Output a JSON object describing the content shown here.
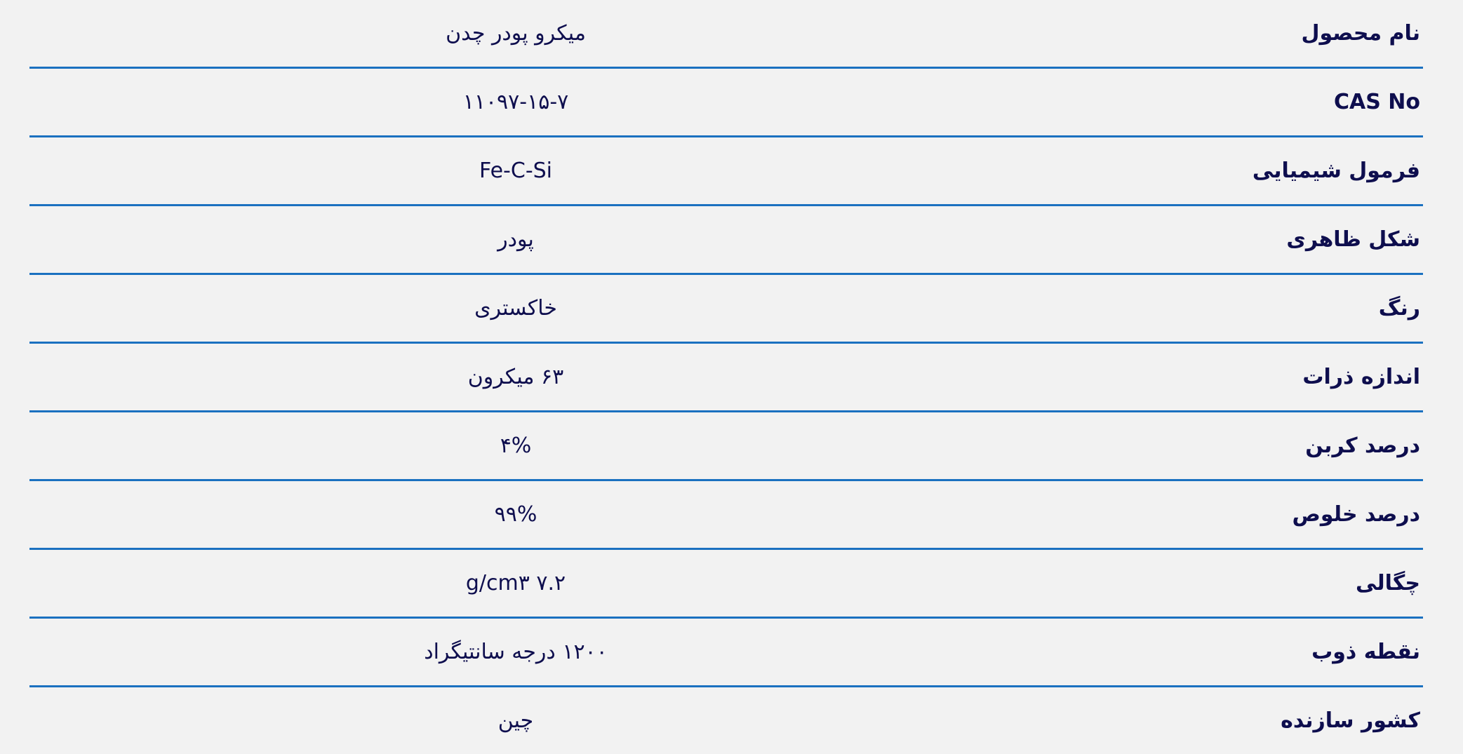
{
  "table": {
    "accent_line_color": "#1b71c0",
    "text_color": "#0e0e4e",
    "background_color": "#f2f2f2",
    "rows": [
      {
        "label": "نام محصول",
        "value": "میکرو پودر چدن"
      },
      {
        "label": "CAS No",
        "value": "۱۱۰۹۷-۱۵-۷"
      },
      {
        "label": "فرمول شیمیایی",
        "value": "Fe-C-Si"
      },
      {
        "label": "شکل ظاهری",
        "value": "پودر"
      },
      {
        "label": "رنگ",
        "value": "خاکستری"
      },
      {
        "label": "اندازه ذرات",
        "value": "۶۳ میکرون"
      },
      {
        "label": "درصد کربن",
        "value": "۴%"
      },
      {
        "label": "درصد خلوص",
        "value": "۹۹%"
      },
      {
        "label": "چگالی",
        "value": "۷.۲ g/cm۳"
      },
      {
        "label": "نقطه ذوب",
        "value": "۱۲۰۰ درجه سانتیگراد"
      },
      {
        "label": "کشور سازنده",
        "value": "چین"
      }
    ]
  }
}
